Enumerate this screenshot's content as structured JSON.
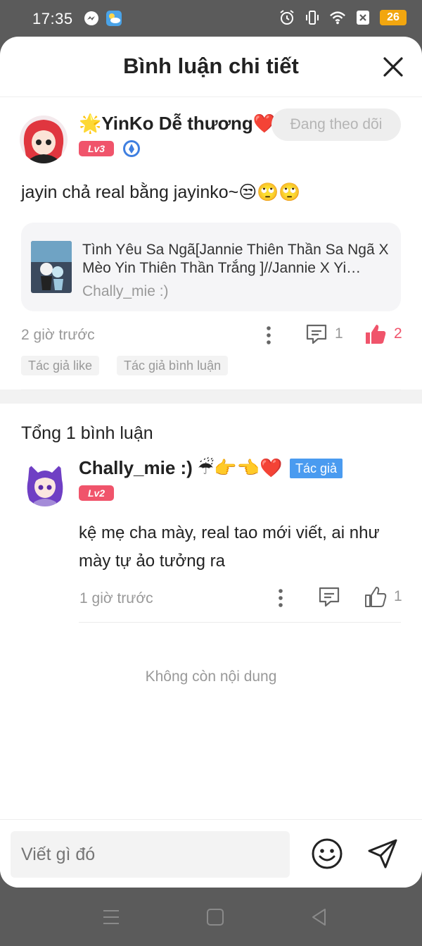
{
  "status_bar": {
    "time": "17:35",
    "battery": "26",
    "left_icons": [
      "messenger-icon",
      "weather-icon"
    ],
    "right_icons": [
      "alarm-icon",
      "vibrate-icon",
      "wifi-icon",
      "sim-off-icon"
    ]
  },
  "header": {
    "title": "Bình luận chi tiết",
    "close_icon": "close-icon"
  },
  "post": {
    "username": "🌟YinKo Dễ thương❤️",
    "level": "Lv3",
    "follow_label": "Đang theo dõi",
    "text": "jayin chả real bằng jayinko~😒🙄🙄",
    "work": {
      "title": "Tình Yêu Sa Ngã[Jannie Thiên Thần Sa Ngã X Mèo Yin Thiên Thần Trắng ]//Jannie X Yi…",
      "author": "Chally_mie :)"
    },
    "time": "2 giờ trước",
    "comment_count": "1",
    "like_count": "2",
    "tags": [
      "Tác giả like",
      "Tác giả bình luận"
    ]
  },
  "comments": {
    "total_label": "Tổng 1 bình luận",
    "items": [
      {
        "username": "Chally_mie :) ☔👉👈❤️",
        "author_badge": "Tác giả",
        "level": "Lv2",
        "text": "kệ mẹ cha mày, real tao mới viết, ai như mày tự ảo tưởng ra",
        "time": "1 giờ trước",
        "like_count": "1"
      }
    ],
    "end_label": "Không còn nội dung"
  },
  "input": {
    "placeholder": "Viết gì đó"
  },
  "colors": {
    "accent_red": "#f0546b",
    "author_blue": "#4a9bf0",
    "battery": "#f2a60f"
  }
}
